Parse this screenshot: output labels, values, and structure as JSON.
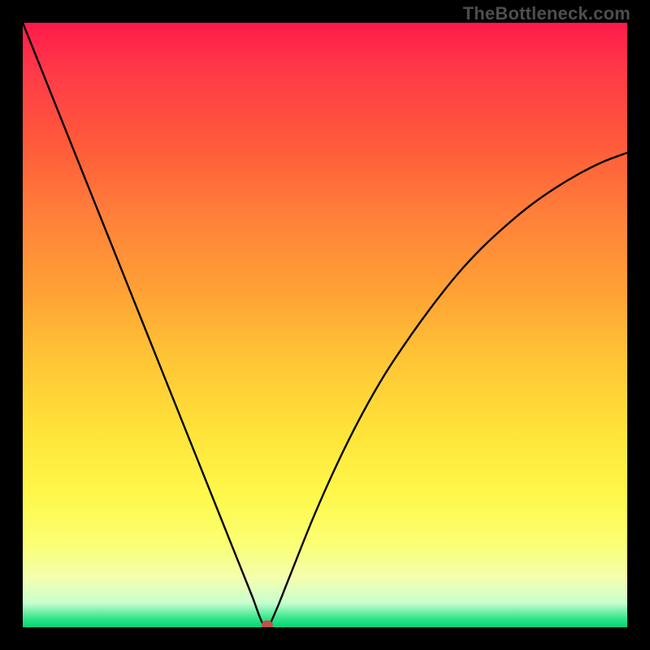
{
  "watermark": "TheBottleneck.com",
  "chart_data": {
    "type": "line",
    "title": "",
    "xlabel": "",
    "ylabel": "",
    "xlim": [
      0,
      100
    ],
    "ylim": [
      0,
      100
    ],
    "series": [
      {
        "name": "curve",
        "x": [
          0,
          4,
          8,
          12,
          16,
          20,
          24,
          28,
          32,
          34,
          36,
          38,
          39.5,
          40.5,
          42,
          44,
          48,
          52,
          56,
          60,
          64,
          68,
          72,
          76,
          80,
          84,
          88,
          92,
          96,
          100
        ],
        "y": [
          100,
          90,
          80,
          70,
          60,
          50,
          40,
          30,
          20,
          15,
          10,
          5,
          1,
          0,
          3,
          8,
          18,
          27,
          35,
          42,
          48,
          53.5,
          58.5,
          62.8,
          66.5,
          69.8,
          72.6,
          75,
          77,
          78.5
        ]
      }
    ],
    "marker": {
      "x": 40.5,
      "y": 0
    },
    "gradient_direction": "top-to-bottom",
    "gradient_stops": [
      {
        "pct": 0,
        "color": "#ff1a4a"
      },
      {
        "pct": 50,
        "color": "#ffb838"
      },
      {
        "pct": 80,
        "color": "#fff84a"
      },
      {
        "pct": 100,
        "color": "#00d478"
      }
    ]
  }
}
